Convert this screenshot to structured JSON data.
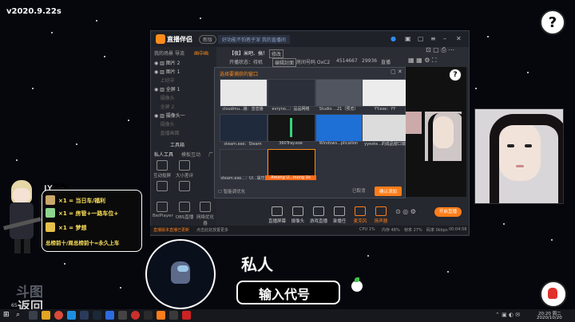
{
  "overlay": {
    "version": "v2020.9.22s",
    "help_glyph": "?",
    "private_label": "私人",
    "code_label": "输入代号",
    "watermark": "斗图",
    "return_label": "返回",
    "corner_number": "65"
  },
  "app": {
    "brand": "直播伴侣",
    "badge": "新版",
    "notice": "好功能不怕巷子深 我的直播间",
    "left_tabs": [
      "我的场景",
      "导流",
      "画中画"
    ],
    "scenes": [
      {
        "label": "图片 2",
        "dim": false
      },
      {
        "label": "图片 1",
        "dim": false
      },
      {
        "label": "上班中",
        "dim": true
      },
      {
        "label": "全屏 1",
        "dim": false
      },
      {
        "label": "摄像头",
        "dim": true
      },
      {
        "label": "全屏 2",
        "dim": true
      },
      {
        "label": "摄像头一",
        "dim": false
      },
      {
        "label": "摄像头",
        "dim": true
      },
      {
        "label": "直播画面",
        "dim": true
      }
    ],
    "toolbox_label": "工具箱",
    "tool_sections": [
      "私人工具",
      "模板互动",
      "广"
    ],
    "tools": [
      "互动投屏",
      "大小差评",
      "",
      "",
      "",
      "",
      "BeiPlayer",
      "OBS直播",
      "网络优化器"
    ],
    "stream_title": "【夜】米吧、搞！",
    "stream_title_btn": "修改",
    "stream_meta": [
      "开播状态：待机",
      "编辑封面",
      "房间号码 OxC2",
      "4514667",
      "29936",
      "直播"
    ],
    "dialog": {
      "title": "选择要捕获的窗口",
      "sources": [
        {
          "label": "cloudmu...播：音音播",
          "selected": false
        },
        {
          "label": "evryno...：品品网络",
          "selected": false
        },
        {
          "label": "Studio ...21（预览）",
          "selected": false
        },
        {
          "label": "YY.exe：YY",
          "selected": false
        },
        {
          "label": "steam.exe：Steam",
          "selected": false
        },
        {
          "label": "360Tray.exe",
          "selected": false
        },
        {
          "label": "Windows...plication",
          "selected": false
        },
        {
          "label": "yyexte...的成品窗口端",
          "selected": false
        },
        {
          "label": "steam.exe...：Ui...属性",
          "selected": false
        },
        {
          "label": "Among U...mong Us",
          "selected": true
        }
      ],
      "checkbox_label": "智能调优化",
      "cancel": "已取消",
      "confirm": "确认添加"
    },
    "bottom_controls": [
      "直播屏幕",
      "摄像头",
      "游戏直播",
      "录播任",
      "麦克风",
      "扬声器"
    ],
    "start_live": "开启直播",
    "status": [
      "直播版本直播已更新",
      "点击此处放置更多",
      "CPU 1%",
      "内存 48%",
      "帧率 27%",
      "码率 0kbps",
      "00:04:58"
    ]
  },
  "jy": {
    "title": "JY互粉",
    "lines": [
      {
        "text": "×1 = 当日车/福利",
        "color": "#ffe25a"
      },
      {
        "text": "×1 = 房管+一路车位+",
        "color": "#ffe25a"
      },
      {
        "text": "×1 = 梦想",
        "color": "#ffe25a"
      },
      {
        "text": "总榜前十/周总榜前十=永久上车",
        "color": "#ffe25a"
      }
    ]
  },
  "taskbar": {
    "time": "20:20 周二",
    "date": "2020/10/20"
  },
  "colors": {
    "accent": "#ff7d1a",
    "background": "#05070d",
    "app_bg": "#25282f"
  }
}
